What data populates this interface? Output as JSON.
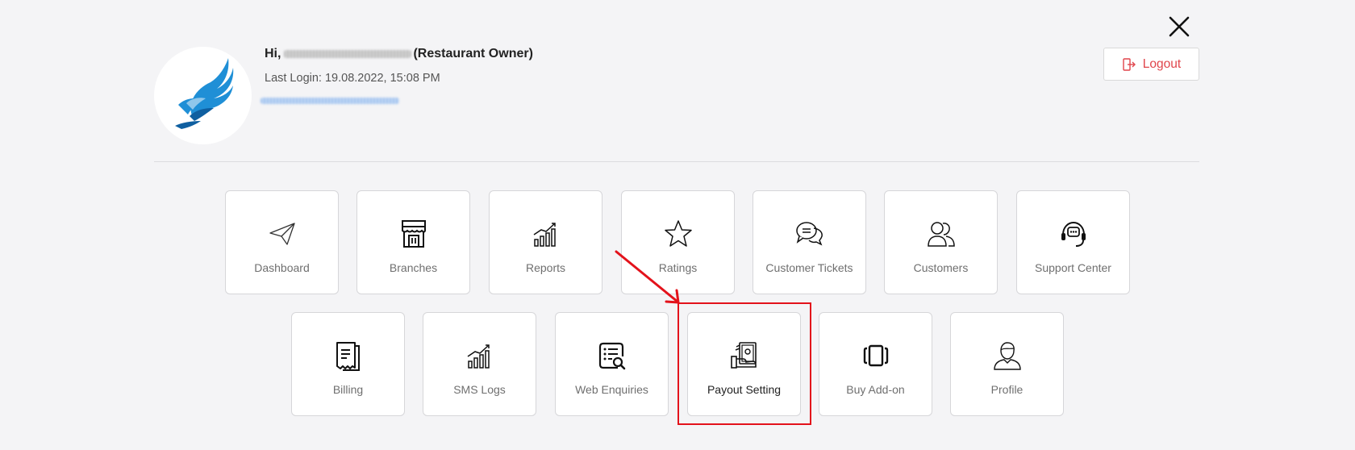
{
  "header": {
    "greeting_prefix": "Hi,",
    "role": "(Restaurant Owner)",
    "last_login": "Last Login: 19.08.2022, 15:08 PM",
    "logout_label": "Logout"
  },
  "menu": {
    "row1": [
      {
        "label": "Dashboard",
        "icon": "paper-plane-icon"
      },
      {
        "label": "Branches",
        "icon": "storefront-icon"
      },
      {
        "label": "Reports",
        "icon": "bar-chart-trend-icon"
      },
      {
        "label": "Ratings",
        "icon": "star-icon"
      },
      {
        "label": "Customer Tickets",
        "icon": "chat-bubbles-icon"
      },
      {
        "label": "Customers",
        "icon": "users-icon"
      },
      {
        "label": "Support Center",
        "icon": "headset-icon"
      }
    ],
    "row2": [
      {
        "label": "Billing",
        "icon": "receipt-icon"
      },
      {
        "label": "SMS Logs",
        "icon": "bar-chart-trend-icon"
      },
      {
        "label": "Web Enquiries",
        "icon": "list-search-icon"
      },
      {
        "label": "Payout Setting",
        "icon": "cash-hand-icon",
        "highlighted": true
      },
      {
        "label": "Buy Add-on",
        "icon": "card-stack-icon"
      },
      {
        "label": "Profile",
        "icon": "user-profile-icon"
      }
    ]
  },
  "colors": {
    "accent_red": "#e0454b",
    "highlight_red": "#e3121b",
    "brand_blue": "#1f8fd6"
  }
}
